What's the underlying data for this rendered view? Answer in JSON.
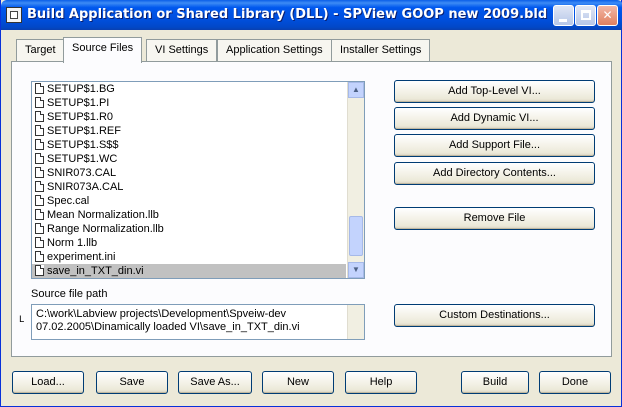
{
  "window": {
    "title": "Build Application or Shared Library (DLL) - SPView GOOP new 2009.bld"
  },
  "tabs": [
    {
      "label": "Target"
    },
    {
      "label": "Source Files"
    },
    {
      "label": "VI Settings"
    },
    {
      "label": "Application Settings"
    },
    {
      "label": "Installer Settings"
    }
  ],
  "active_tab": "Source Files",
  "file_list": {
    "items": [
      "SETUP$1.BG",
      "SETUP$1.PI",
      "SETUP$1.R0",
      "SETUP$1.REF",
      "SETUP$1.S$$",
      "SETUP$1.WC",
      "SNIR073.CAL",
      "SNIR073A.CAL",
      "Spec.cal",
      "Mean Normalization.llb",
      "Range Normalization.llb",
      "Norm 1.llb",
      "experiment.ini",
      "save_in_TXT_din.vi"
    ],
    "selected": "save_in_TXT_din.vi"
  },
  "side_buttons": {
    "add_top_level": "Add Top-Level VI...",
    "add_dynamic": "Add Dynamic VI...",
    "add_support": "Add Support File...",
    "add_directory": "Add Directory Contents...",
    "remove_file": "Remove File",
    "custom_destinations": "Custom Destinations..."
  },
  "source_path": {
    "label": "Source file path",
    "line1": "C:\\work\\Labview projects\\Development\\Spveiw-dev",
    "line2": "07.02.2005\\Dinamically loaded VI\\save_in_TXT_din.vi"
  },
  "bottom_buttons": {
    "load": "Load...",
    "save": "Save",
    "save_as": "Save As...",
    "new": "New",
    "help": "Help",
    "build": "Build",
    "done": "Done"
  }
}
